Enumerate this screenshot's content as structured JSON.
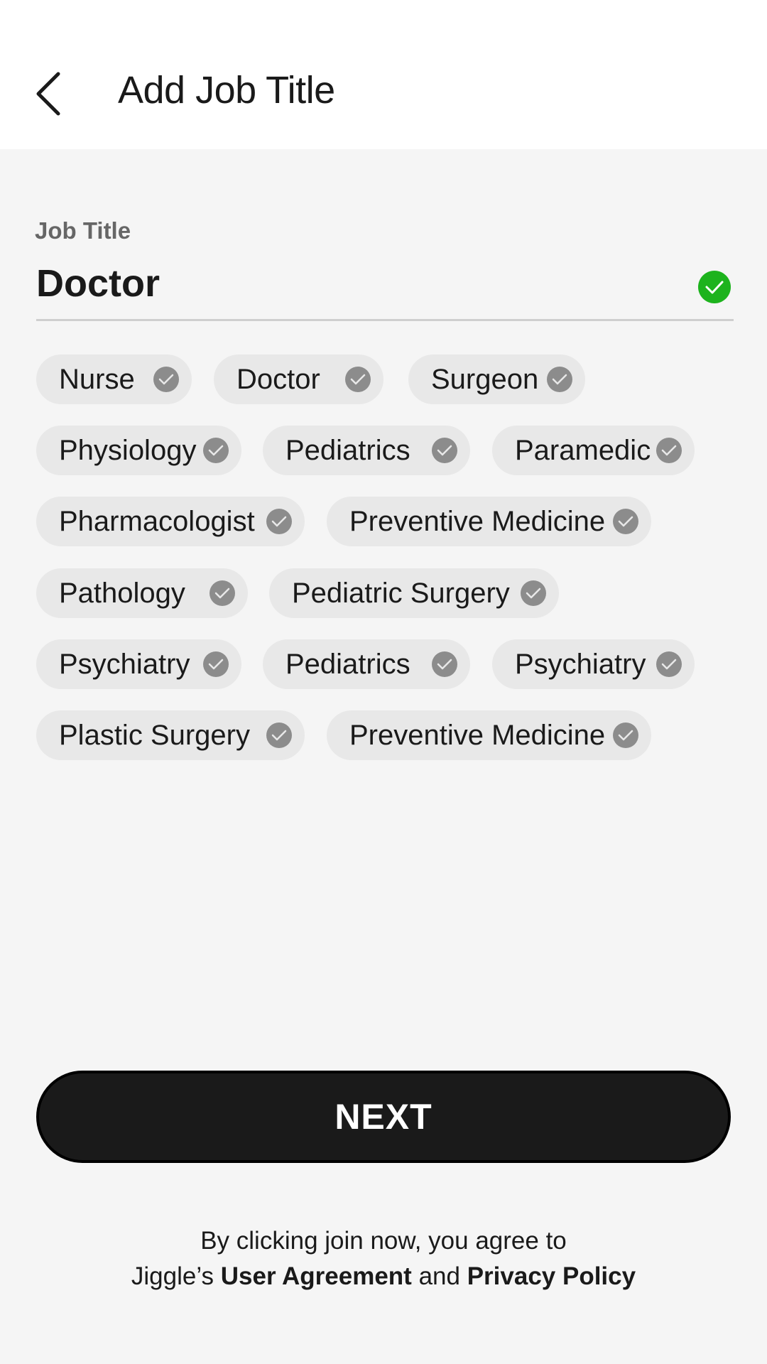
{
  "header": {
    "title": "Add Job Title"
  },
  "field": {
    "label": "Job Title",
    "value": "Doctor"
  },
  "chips": [
    "Nurse",
    "Doctor",
    "Surgeon",
    "Physiology",
    "Pediatrics",
    "Paramedic",
    "Pharmacologist",
    "Preventive Medicine",
    "Pathology",
    "Pediatric Surgery",
    "Psychiatry",
    "Pediatrics",
    "Psychiatry",
    "Plastic Surgery",
    "Preventive Medicine"
  ],
  "next_label": "NEXT",
  "legal": {
    "line1": "By clicking join now, you agree to",
    "prefix": "Jiggle’s",
    "user_agreement": "User Agreement",
    "and": "and",
    "privacy_policy": "Privacy Policy"
  },
  "colors": {
    "valid": "#1db31d",
    "chip_bg": "#e8e8e8",
    "chip_check": "#8c8c8c",
    "button": "#1a1a1a"
  },
  "icons": {
    "back": "chevron-left-icon",
    "valid": "check-circle-icon",
    "chip": "check-circle-icon"
  }
}
